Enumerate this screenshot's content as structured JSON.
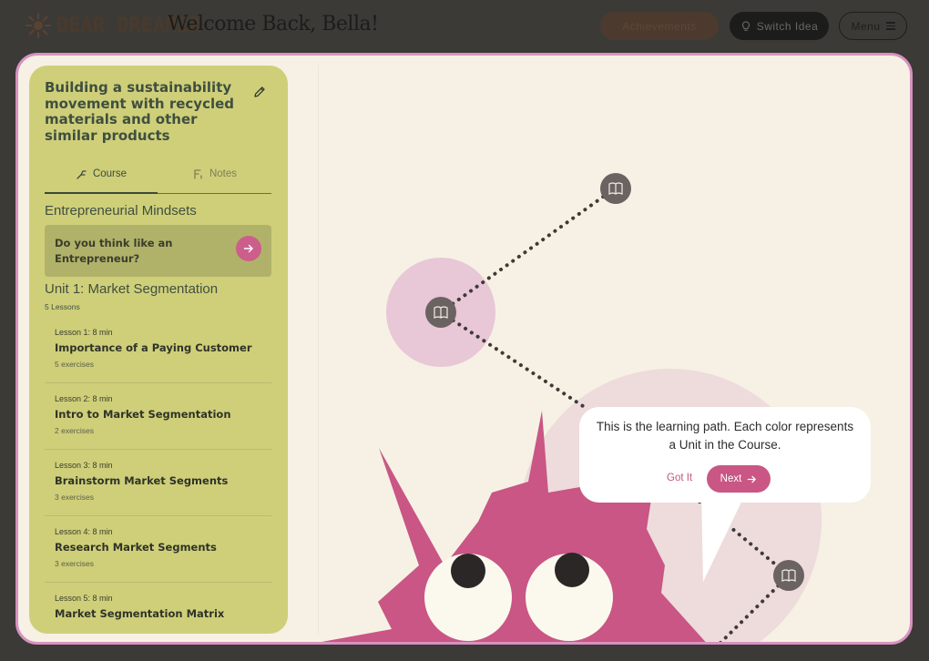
{
  "header": {
    "logo_text": "DEAR DREAMER",
    "welcome": "Welcome Back, Bella!",
    "achievements_label": "Achievements",
    "switch_idea_label": "Switch Idea",
    "menu_label": "Menu"
  },
  "sidebar": {
    "course_title": "Building a sustainability movement with recycled materials and other similar products",
    "tabs": [
      {
        "label": "Course",
        "icon": "course-icon",
        "active": true
      },
      {
        "label": "Notes",
        "icon": "notes-icon",
        "active": false
      }
    ],
    "section_title": "Entrepreneurial Mindsets",
    "mindset_card": {
      "text": "Do you think like an Entrepreneur?"
    },
    "unit": {
      "title": "Unit 1: Market Segmentation",
      "count": "5 Lessons"
    },
    "lessons": [
      {
        "meta": "Lesson 1:  8 min",
        "title": "Importance of a Paying Customer",
        "exercises": "5 exercises"
      },
      {
        "meta": "Lesson 2:  8 min",
        "title": "Intro to Market Segmentation",
        "exercises": "2 exercises"
      },
      {
        "meta": "Lesson 3:  8 min",
        "title": "Brainstorm Market Segments",
        "exercises": "3 exercises"
      },
      {
        "meta": "Lesson 4:  8 min",
        "title": "Research Market Segments",
        "exercises": "3 exercises"
      },
      {
        "meta": "Lesson 5:  8 min",
        "title": "Market Segmentation Matrix",
        "exercises": ""
      }
    ]
  },
  "tooltip": {
    "text": "This is the learning path. Each color represents a Unit in the Course.",
    "got_it_label": "Got It",
    "next_label": "Next"
  },
  "colors": {
    "background": "#3b3a37",
    "frame": "#f6f1e4",
    "frame_border": "#d792c0",
    "sidebar": "#cfcf7a",
    "accent_pink": "#c95684",
    "node": "#6b6361",
    "mascot": "#c95684"
  }
}
